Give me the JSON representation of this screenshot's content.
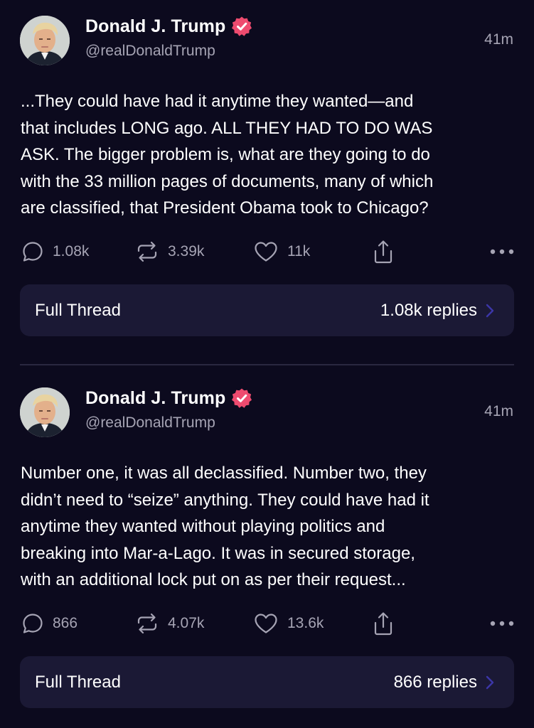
{
  "colors": {
    "background": "#0c0a1e",
    "card": "#1b1935",
    "muted_text": "#a6a4b4",
    "verified_badge": "#ee4b6f",
    "chevron": "#3c36a8"
  },
  "posts": [
    {
      "author": "Donald J. Trump",
      "handle": "@realDonaldTrump",
      "time": "41m",
      "text": "...They could have had it anytime they wanted—and\nthat includes LONG ago. ALL THEY HAD TO DO WAS\nASK. The bigger problem is, what are they going to do\nwith the 33 million pages of documents, many of which\nare classified, that President Obama took to Chicago?",
      "replies": "1.08k",
      "reposts": "3.39k",
      "likes": "11k",
      "thread_label": "Full Thread",
      "thread_count": "1.08k replies"
    },
    {
      "author": "Donald J. Trump",
      "handle": "@realDonaldTrump",
      "time": "41m",
      "text": "Number one, it was all declassified. Number two, they\ndidn’t need to “seize” anything. They could have had it\nanytime they wanted without playing politics and\nbreaking into Mar-a-Lago. It was in secured storage,\nwith an additional lock put on as per their request...",
      "replies": "866",
      "reposts": "4.07k",
      "likes": "13.6k",
      "thread_label": "Full Thread",
      "thread_count": "866 replies"
    }
  ],
  "icons": {
    "verified": "verified-badge-icon",
    "reply": "comment-bubble-icon",
    "repost": "repost-arrows-icon",
    "like": "heart-icon",
    "share": "share-upload-icon",
    "more": "more-dots-icon",
    "chevron": "chevron-right-icon"
  }
}
